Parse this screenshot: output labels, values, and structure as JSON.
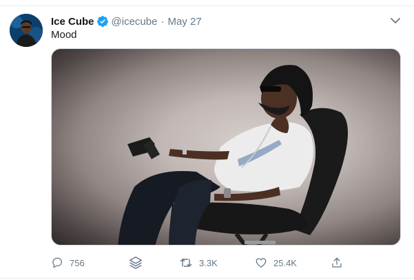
{
  "tweet": {
    "author_name": "Ice Cube",
    "handle": "@icecube",
    "separator": "·",
    "date": "May 27",
    "text": "Mood",
    "verified": true
  },
  "actions": {
    "reply_count": "756",
    "retweet_count": "3.3K",
    "like_count": "25.4K"
  },
  "colors": {
    "text": "#14171a",
    "secondary": "#657786",
    "verified": "#1da1f2",
    "divider": "#e6ecf0"
  },
  "icons": [
    "verified-badge-icon",
    "chevron-down-icon",
    "reply-icon",
    "layers-icon",
    "retweet-icon",
    "like-icon",
    "share-icon"
  ]
}
